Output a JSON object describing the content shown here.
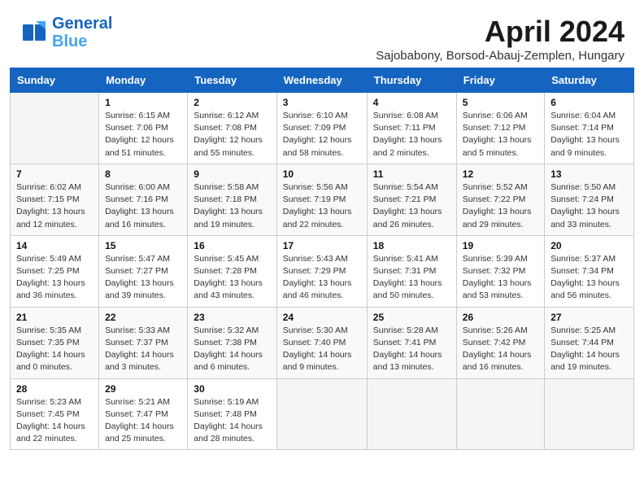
{
  "header": {
    "logo_line1": "General",
    "logo_line2": "Blue",
    "month": "April 2024",
    "location": "Sajobabony, Borsod-Abauj-Zemplen, Hungary"
  },
  "days_of_week": [
    "Sunday",
    "Monday",
    "Tuesday",
    "Wednesday",
    "Thursday",
    "Friday",
    "Saturday"
  ],
  "weeks": [
    [
      {
        "day": "",
        "detail": ""
      },
      {
        "day": "1",
        "detail": "Sunrise: 6:15 AM\nSunset: 7:06 PM\nDaylight: 12 hours\nand 51 minutes."
      },
      {
        "day": "2",
        "detail": "Sunrise: 6:12 AM\nSunset: 7:08 PM\nDaylight: 12 hours\nand 55 minutes."
      },
      {
        "day": "3",
        "detail": "Sunrise: 6:10 AM\nSunset: 7:09 PM\nDaylight: 12 hours\nand 58 minutes."
      },
      {
        "day": "4",
        "detail": "Sunrise: 6:08 AM\nSunset: 7:11 PM\nDaylight: 13 hours\nand 2 minutes."
      },
      {
        "day": "5",
        "detail": "Sunrise: 6:06 AM\nSunset: 7:12 PM\nDaylight: 13 hours\nand 5 minutes."
      },
      {
        "day": "6",
        "detail": "Sunrise: 6:04 AM\nSunset: 7:14 PM\nDaylight: 13 hours\nand 9 minutes."
      }
    ],
    [
      {
        "day": "7",
        "detail": "Sunrise: 6:02 AM\nSunset: 7:15 PM\nDaylight: 13 hours\nand 12 minutes."
      },
      {
        "day": "8",
        "detail": "Sunrise: 6:00 AM\nSunset: 7:16 PM\nDaylight: 13 hours\nand 16 minutes."
      },
      {
        "day": "9",
        "detail": "Sunrise: 5:58 AM\nSunset: 7:18 PM\nDaylight: 13 hours\nand 19 minutes."
      },
      {
        "day": "10",
        "detail": "Sunrise: 5:56 AM\nSunset: 7:19 PM\nDaylight: 13 hours\nand 22 minutes."
      },
      {
        "day": "11",
        "detail": "Sunrise: 5:54 AM\nSunset: 7:21 PM\nDaylight: 13 hours\nand 26 minutes."
      },
      {
        "day": "12",
        "detail": "Sunrise: 5:52 AM\nSunset: 7:22 PM\nDaylight: 13 hours\nand 29 minutes."
      },
      {
        "day": "13",
        "detail": "Sunrise: 5:50 AM\nSunset: 7:24 PM\nDaylight: 13 hours\nand 33 minutes."
      }
    ],
    [
      {
        "day": "14",
        "detail": "Sunrise: 5:49 AM\nSunset: 7:25 PM\nDaylight: 13 hours\nand 36 minutes."
      },
      {
        "day": "15",
        "detail": "Sunrise: 5:47 AM\nSunset: 7:27 PM\nDaylight: 13 hours\nand 39 minutes."
      },
      {
        "day": "16",
        "detail": "Sunrise: 5:45 AM\nSunset: 7:28 PM\nDaylight: 13 hours\nand 43 minutes."
      },
      {
        "day": "17",
        "detail": "Sunrise: 5:43 AM\nSunset: 7:29 PM\nDaylight: 13 hours\nand 46 minutes."
      },
      {
        "day": "18",
        "detail": "Sunrise: 5:41 AM\nSunset: 7:31 PM\nDaylight: 13 hours\nand 50 minutes."
      },
      {
        "day": "19",
        "detail": "Sunrise: 5:39 AM\nSunset: 7:32 PM\nDaylight: 13 hours\nand 53 minutes."
      },
      {
        "day": "20",
        "detail": "Sunrise: 5:37 AM\nSunset: 7:34 PM\nDaylight: 13 hours\nand 56 minutes."
      }
    ],
    [
      {
        "day": "21",
        "detail": "Sunrise: 5:35 AM\nSunset: 7:35 PM\nDaylight: 14 hours\nand 0 minutes."
      },
      {
        "day": "22",
        "detail": "Sunrise: 5:33 AM\nSunset: 7:37 PM\nDaylight: 14 hours\nand 3 minutes."
      },
      {
        "day": "23",
        "detail": "Sunrise: 5:32 AM\nSunset: 7:38 PM\nDaylight: 14 hours\nand 6 minutes."
      },
      {
        "day": "24",
        "detail": "Sunrise: 5:30 AM\nSunset: 7:40 PM\nDaylight: 14 hours\nand 9 minutes."
      },
      {
        "day": "25",
        "detail": "Sunrise: 5:28 AM\nSunset: 7:41 PM\nDaylight: 14 hours\nand 13 minutes."
      },
      {
        "day": "26",
        "detail": "Sunrise: 5:26 AM\nSunset: 7:42 PM\nDaylight: 14 hours\nand 16 minutes."
      },
      {
        "day": "27",
        "detail": "Sunrise: 5:25 AM\nSunset: 7:44 PM\nDaylight: 14 hours\nand 19 minutes."
      }
    ],
    [
      {
        "day": "28",
        "detail": "Sunrise: 5:23 AM\nSunset: 7:45 PM\nDaylight: 14 hours\nand 22 minutes."
      },
      {
        "day": "29",
        "detail": "Sunrise: 5:21 AM\nSunset: 7:47 PM\nDaylight: 14 hours\nand 25 minutes."
      },
      {
        "day": "30",
        "detail": "Sunrise: 5:19 AM\nSunset: 7:48 PM\nDaylight: 14 hours\nand 28 minutes."
      },
      {
        "day": "",
        "detail": ""
      },
      {
        "day": "",
        "detail": ""
      },
      {
        "day": "",
        "detail": ""
      },
      {
        "day": "",
        "detail": ""
      }
    ]
  ]
}
